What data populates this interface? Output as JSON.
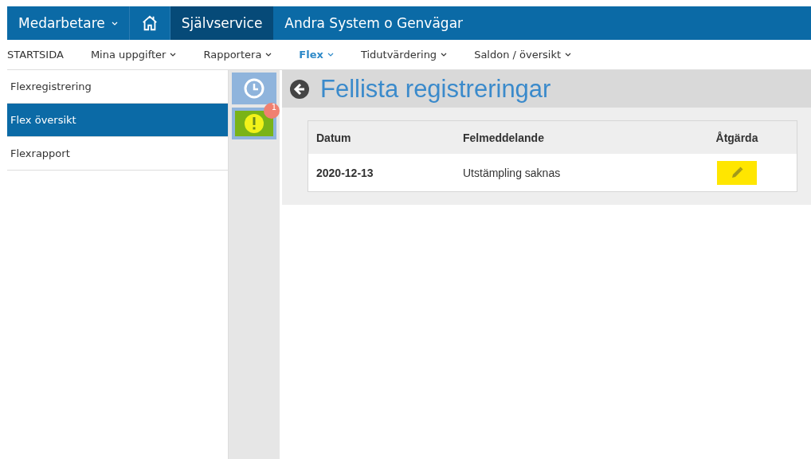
{
  "top_nav": [
    {
      "kind": "dropdown",
      "label": "Medarbetare",
      "selected": false
    },
    {
      "kind": "home",
      "selected": false
    },
    {
      "kind": "link",
      "label": "Självservice",
      "selected": true
    },
    {
      "kind": "link",
      "label": "Andra System o Genvägar",
      "selected": false
    }
  ],
  "menu": [
    {
      "label": "STARTSIDA",
      "dropdown": false,
      "selected": false
    },
    {
      "label": "Mina uppgifter",
      "dropdown": true,
      "selected": false
    },
    {
      "label": "Rapportera",
      "dropdown": true,
      "selected": false
    },
    {
      "label": "Flex",
      "dropdown": true,
      "selected": true
    },
    {
      "label": "Tidutvärdering",
      "dropdown": true,
      "selected": false
    },
    {
      "label": "Saldon / översikt",
      "dropdown": true,
      "selected": false
    }
  ],
  "sidebar": {
    "items": [
      {
        "label": "Flexregistrering",
        "selected": false
      },
      {
        "label": "Flex översikt",
        "selected": true
      },
      {
        "label": "Flexrapport",
        "selected": false
      }
    ]
  },
  "tool_buttons": [
    {
      "kind": "clock",
      "selected": false
    },
    {
      "kind": "warning",
      "selected": true,
      "badge": "1"
    }
  ],
  "page": {
    "title": "Fellista registreringar"
  },
  "table": {
    "columns": [
      "Datum",
      "Felmeddelande",
      "Åtgärda"
    ],
    "rows": [
      {
        "date": "2020-12-13",
        "message": "Utstämpling saknas",
        "action": {
          "kind": "edit"
        }
      }
    ]
  }
}
